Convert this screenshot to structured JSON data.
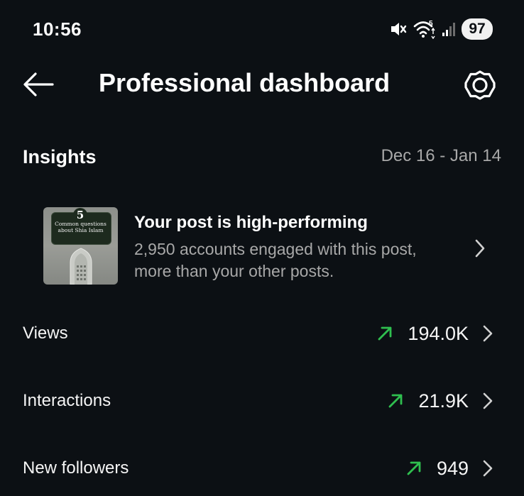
{
  "status_bar": {
    "time": "10:56",
    "wifi_label": "5",
    "battery": "97",
    "icons": [
      "mute-icon",
      "wifi-icon",
      "signal-icon"
    ]
  },
  "header": {
    "title": "Professional dashboard",
    "icons": [
      "back-arrow-icon",
      "settings-gear-icon"
    ]
  },
  "insights": {
    "title": "Insights",
    "date_range": "Dec 16 - Jan 14"
  },
  "highlight": {
    "thumbnail": {
      "number": "5",
      "caption": "Common questions about Shia Islam"
    },
    "heading": "Your post is high-performing",
    "description": "2,950 accounts engaged with this post, more than your other posts."
  },
  "metrics": [
    {
      "label": "Views",
      "value": "194.0K",
      "trend": "up"
    },
    {
      "label": "Interactions",
      "value": "21.9K",
      "trend": "up"
    },
    {
      "label": "New followers",
      "value": "949",
      "trend": "up"
    }
  ],
  "colors": {
    "background": "#0c1014",
    "text_primary": "#f5f5f5",
    "text_secondary": "#a8a8a8",
    "trend_up": "#2fbf4f"
  }
}
